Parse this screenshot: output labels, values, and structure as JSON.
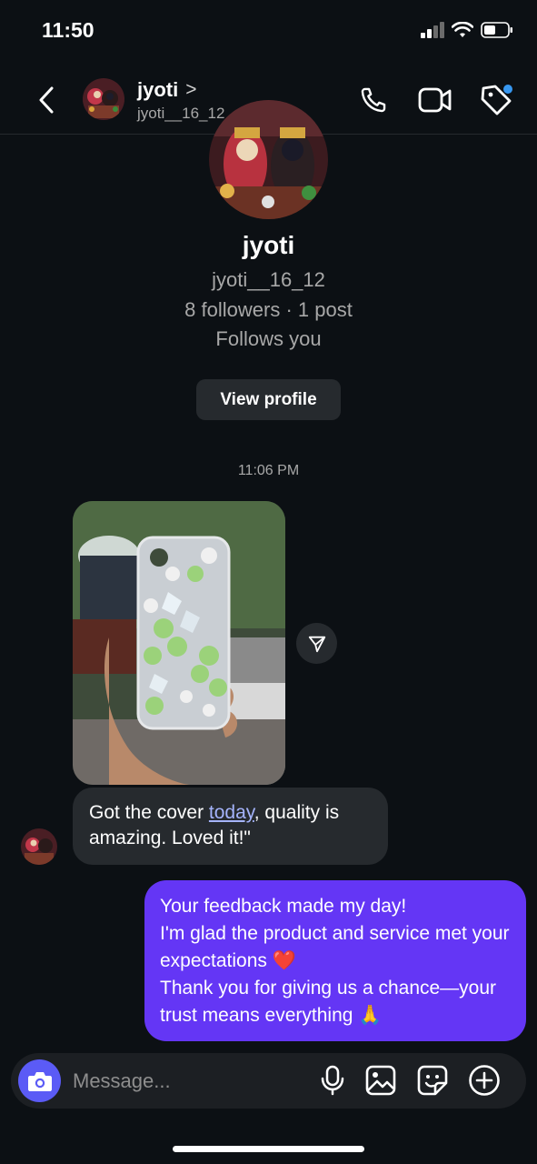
{
  "status_bar": {
    "time": "11:50"
  },
  "header": {
    "name": "jyoti",
    "username": "jyoti__16_12",
    "chevron": ">"
  },
  "profile": {
    "name": "jyoti",
    "username": "jyoti__16_12",
    "stats": "8 followers · 1 post",
    "follows_text": "Follows you",
    "view_profile_label": "View profile"
  },
  "thread": {
    "timestamp": "11:06 PM",
    "incoming": {
      "text_before": "Got the cover ",
      "link_text": "today",
      "text_after": ", quality is amazing. Loved it!\""
    },
    "outgoing": {
      "line1": "Your feedback made my day!",
      "line2": "I'm glad the product and service met your expectations ❤️",
      "line3": "Thank you for giving us a chance—your trust means everything 🙏"
    }
  },
  "composer": {
    "placeholder": "Message..."
  },
  "colors": {
    "background": "#0c1014",
    "bubble_incoming": "#262a2e",
    "bubble_outgoing": "#6436f5",
    "camera_button": "#5b5bf6",
    "notification_dot": "#3797f0"
  },
  "icons": [
    "back-icon",
    "phone-icon",
    "video-icon",
    "tag-icon",
    "send-icon",
    "camera-icon",
    "microphone-icon",
    "gallery-icon",
    "sticker-icon",
    "plus-icon"
  ]
}
